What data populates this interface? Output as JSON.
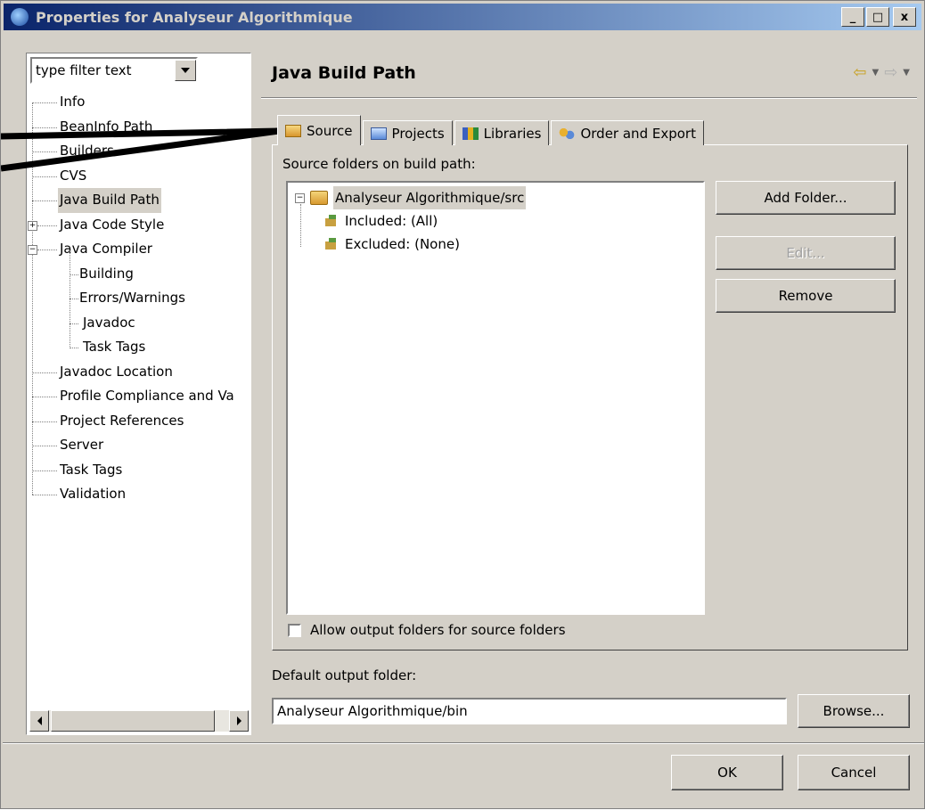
{
  "window": {
    "title": "Properties for Analyseur Algorithmique",
    "controls": [
      "_",
      "□",
      "x"
    ]
  },
  "filter": {
    "value": "type filter text"
  },
  "tree": {
    "items": [
      {
        "label": "Info"
      },
      {
        "label": "BeanInfo Path"
      },
      {
        "label": "Builders"
      },
      {
        "label": "CVS"
      },
      {
        "label": "Java Build Path",
        "selected": true
      },
      {
        "label": "Java Code Style"
      },
      {
        "label": "Java Compiler"
      },
      {
        "label": "Building"
      },
      {
        "label": "Errors/Warnings"
      },
      {
        "label": "Javadoc"
      },
      {
        "label": "Task Tags"
      },
      {
        "label": "Javadoc Location"
      },
      {
        "label": "Profile Compliance and Va"
      },
      {
        "label": "Project References"
      },
      {
        "label": "Server"
      },
      {
        "label": "Task Tags"
      },
      {
        "label": "Validation"
      }
    ],
    "expander_plus": "+",
    "expander_minus": "−"
  },
  "header": {
    "title": "Java Build Path"
  },
  "tabs": [
    {
      "label": "Source",
      "active": true,
      "icon": "source-folder-icon"
    },
    {
      "label": "Projects",
      "icon": "projects-icon"
    },
    {
      "label": "Libraries",
      "icon": "libraries-icon"
    },
    {
      "label": "Order and Export",
      "icon": "order-export-icon"
    }
  ],
  "source": {
    "heading": "Source folders on build path:",
    "tree": {
      "root": "Analyseur Algorithmique/src",
      "included": "Included: (All)",
      "excluded": "Excluded: (None)"
    },
    "buttons": {
      "add_folder": "Add Folder...",
      "edit": "Edit...",
      "remove": "Remove"
    },
    "allow_output_label": "Allow output folders for source folders"
  },
  "output": {
    "label": "Default output folder:",
    "value": "Analyseur Algorithmique/bin",
    "browse": "Browse..."
  },
  "footer": {
    "ok": "OK",
    "cancel": "Cancel"
  },
  "colors": {
    "titlebar_start": "#0a246a",
    "titlebar_end": "#a6caf0",
    "dialog_bg": "#d4d0c8"
  }
}
